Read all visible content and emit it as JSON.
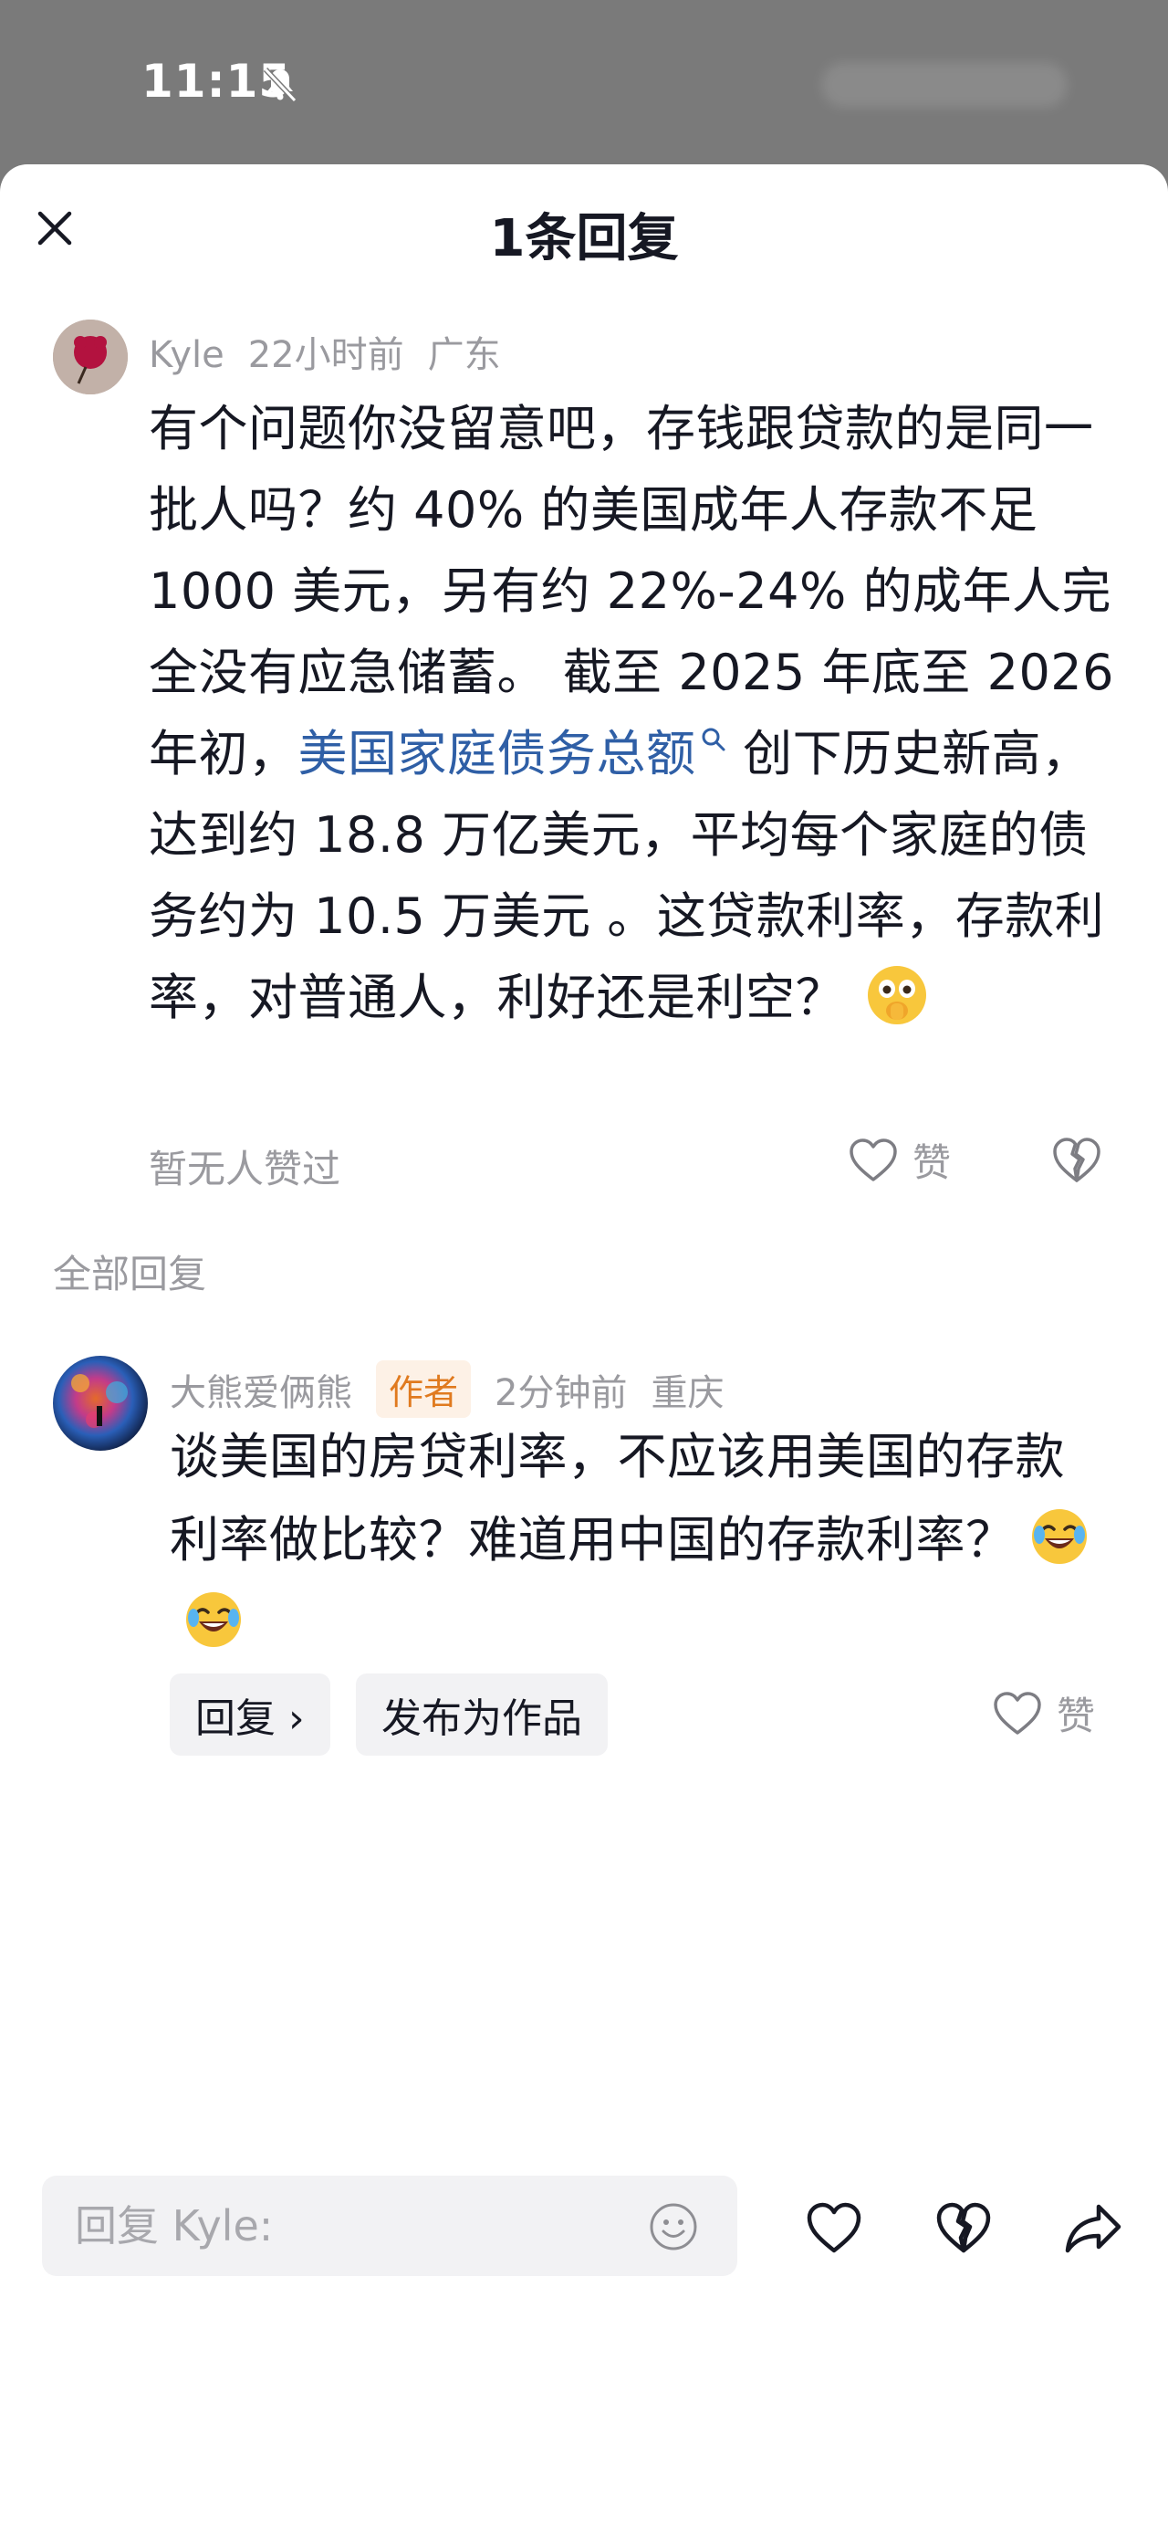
{
  "status_bar": {
    "time": "11:15"
  },
  "sheet": {
    "title": "1条回复"
  },
  "main_comment": {
    "author": "Kyle",
    "time": "22小时前",
    "location": "广东",
    "text_part1": "有个问题你没留意吧，存钱跟贷款的是同一批人吗？约 40% 的美国成年人存款不足 1000 美元，另有约 22%-24% 的成年人完全没有应急储蓄。 截至 2025 年底至 2026 年初，",
    "link_text": "美国家庭债务总额",
    "text_part2": " 创下历史新高，达到约 18.8 万亿美元，平均每个家庭的债务约为 10.5 万美元 。这贷款利率，存款利率，对普通人，利好还是利空？",
    "emoji": "flushed-hand-over-mouth-emoji",
    "no_likes_text": "暂无人赞过",
    "like_label": "赞"
  },
  "section_label": "全部回复",
  "reply": {
    "author": "大熊爱俩熊",
    "badge": "作者",
    "time": "2分钟前",
    "location": "重庆",
    "text": "谈美国的房贷利率，不应该用美国的存款利率做比较？难道用中国的存款利率？",
    "emojis": [
      "rolling-laughing-emoji",
      "rolling-laughing-emoji"
    ],
    "reply_button": "回复 ›",
    "publish_button": "发布为作品",
    "like_label": "赞"
  },
  "bottom_bar": {
    "input_placeholder": "回复 Kyle:"
  },
  "colors": {
    "link": "#2f5fa6",
    "muted": "#9a9a9f",
    "badge_text": "#e07a1f",
    "badge_bg": "#fdf1e6"
  }
}
